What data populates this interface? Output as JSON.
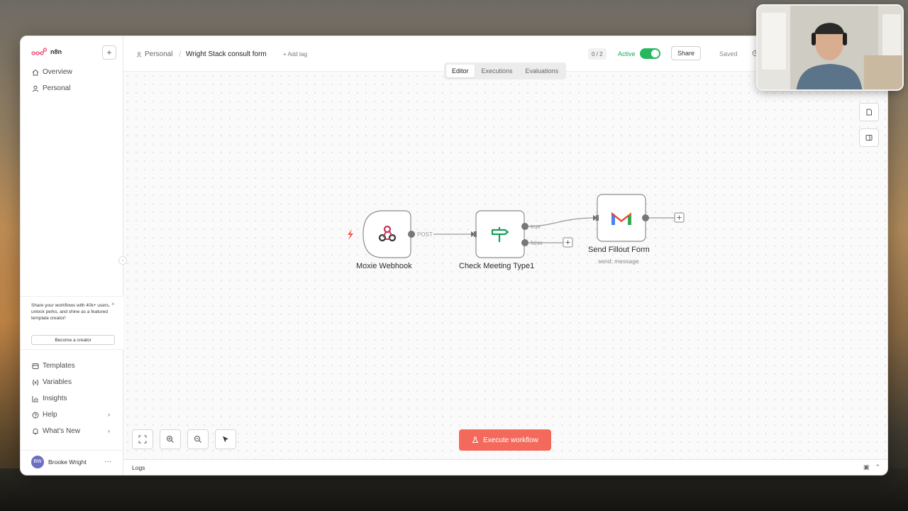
{
  "app": {
    "logo_text": "n8n"
  },
  "sidebar": {
    "add_label": "+",
    "top_items": [
      {
        "label": "Overview",
        "icon": "home-icon"
      },
      {
        "label": "Personal",
        "icon": "user-icon"
      }
    ],
    "promo": {
      "text": "Share your workflows with 40k+ users, unlock perks, and shine as a featured template creator!",
      "close": "×",
      "button": "Become a creator"
    },
    "bottom_items": [
      {
        "label": "Templates",
        "icon": "templates-icon"
      },
      {
        "label": "Variables",
        "icon": "variables-icon"
      },
      {
        "label": "Insights",
        "icon": "insights-icon"
      },
      {
        "label": "Help",
        "icon": "help-icon"
      },
      {
        "label": "What's New",
        "icon": "bell-icon"
      }
    ],
    "user": {
      "initials": "BW",
      "name": "Brooke Wright",
      "more": "···"
    }
  },
  "header": {
    "breadcrumb": "Personal",
    "title": "Wright Stack consult form",
    "add_tag": "+ Add tag",
    "counter": "0 / 2",
    "active_label": "Active",
    "active": true,
    "share": "Share",
    "saved": "Saved"
  },
  "tabs": [
    {
      "label": "Editor",
      "selected": true
    },
    {
      "label": "Executions",
      "selected": false
    },
    {
      "label": "Evaluations",
      "selected": false
    }
  ],
  "nodes": [
    {
      "name": "Moxie Webhook",
      "subtitle": "",
      "icon": "webhook-icon"
    },
    {
      "name": "Check Meeting Type1",
      "subtitle": "",
      "icon": "signpost-icon"
    },
    {
      "name": "Send Fillout Form",
      "subtitle": "send: message",
      "icon": "gmail-icon"
    }
  ],
  "connections": [
    {
      "from": "Moxie Webhook",
      "to": "Check Meeting Type1",
      "label": "POST"
    },
    {
      "from": "Check Meeting Type1",
      "to": "Send Fillout Form",
      "label": "true"
    },
    {
      "from": "Check Meeting Type1",
      "to": "",
      "label": "false"
    }
  ],
  "canvas": {
    "execute_button": "Execute workflow",
    "logs_label": "Logs"
  },
  "colors": {
    "accent": "#f36a5c",
    "active_green": "#27b85f",
    "if_node_green": "#1a9e5a"
  }
}
